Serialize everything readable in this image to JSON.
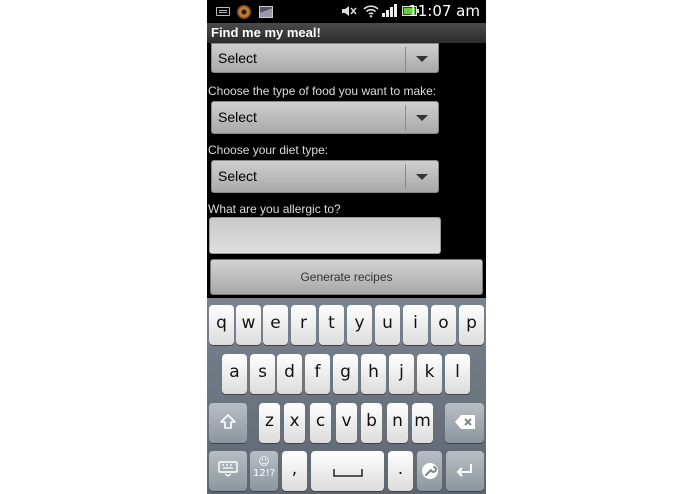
{
  "status_bar": {
    "time": "11:07 am"
  },
  "app": {
    "title": "Find me my meal!"
  },
  "form": {
    "spinner_1": {
      "value": "Select"
    },
    "food_type": {
      "label": "Choose the type of food you want to make:",
      "value": "Select"
    },
    "diet_type": {
      "label": "Choose your diet type:",
      "value": "Select"
    },
    "allergy": {
      "label": "What are you allergic to?",
      "value": ""
    },
    "generate_button": "Generate recipes"
  },
  "keyboard": {
    "row1": [
      "q",
      "w",
      "e",
      "r",
      "t",
      "y",
      "u",
      "i",
      "o",
      "p"
    ],
    "row2": [
      "a",
      "s",
      "d",
      "f",
      "g",
      "h",
      "j",
      "k",
      "l"
    ],
    "row3": [
      "z",
      "x",
      "c",
      "v",
      "b",
      "n",
      "m"
    ],
    "symbols_key": "12!?",
    "emoji_glyph": "☺",
    "comma": ",",
    "period": "."
  },
  "icons": [
    "keyboard-icon",
    "coin-icon",
    "image-icon",
    "mute-icon",
    "wifi-icon",
    "signal-icon",
    "battery-icon",
    "chevron-down-icon",
    "shift-icon",
    "backspace-icon",
    "keyboard-hide-icon",
    "space-icon",
    "settings-icon",
    "enter-icon"
  ]
}
